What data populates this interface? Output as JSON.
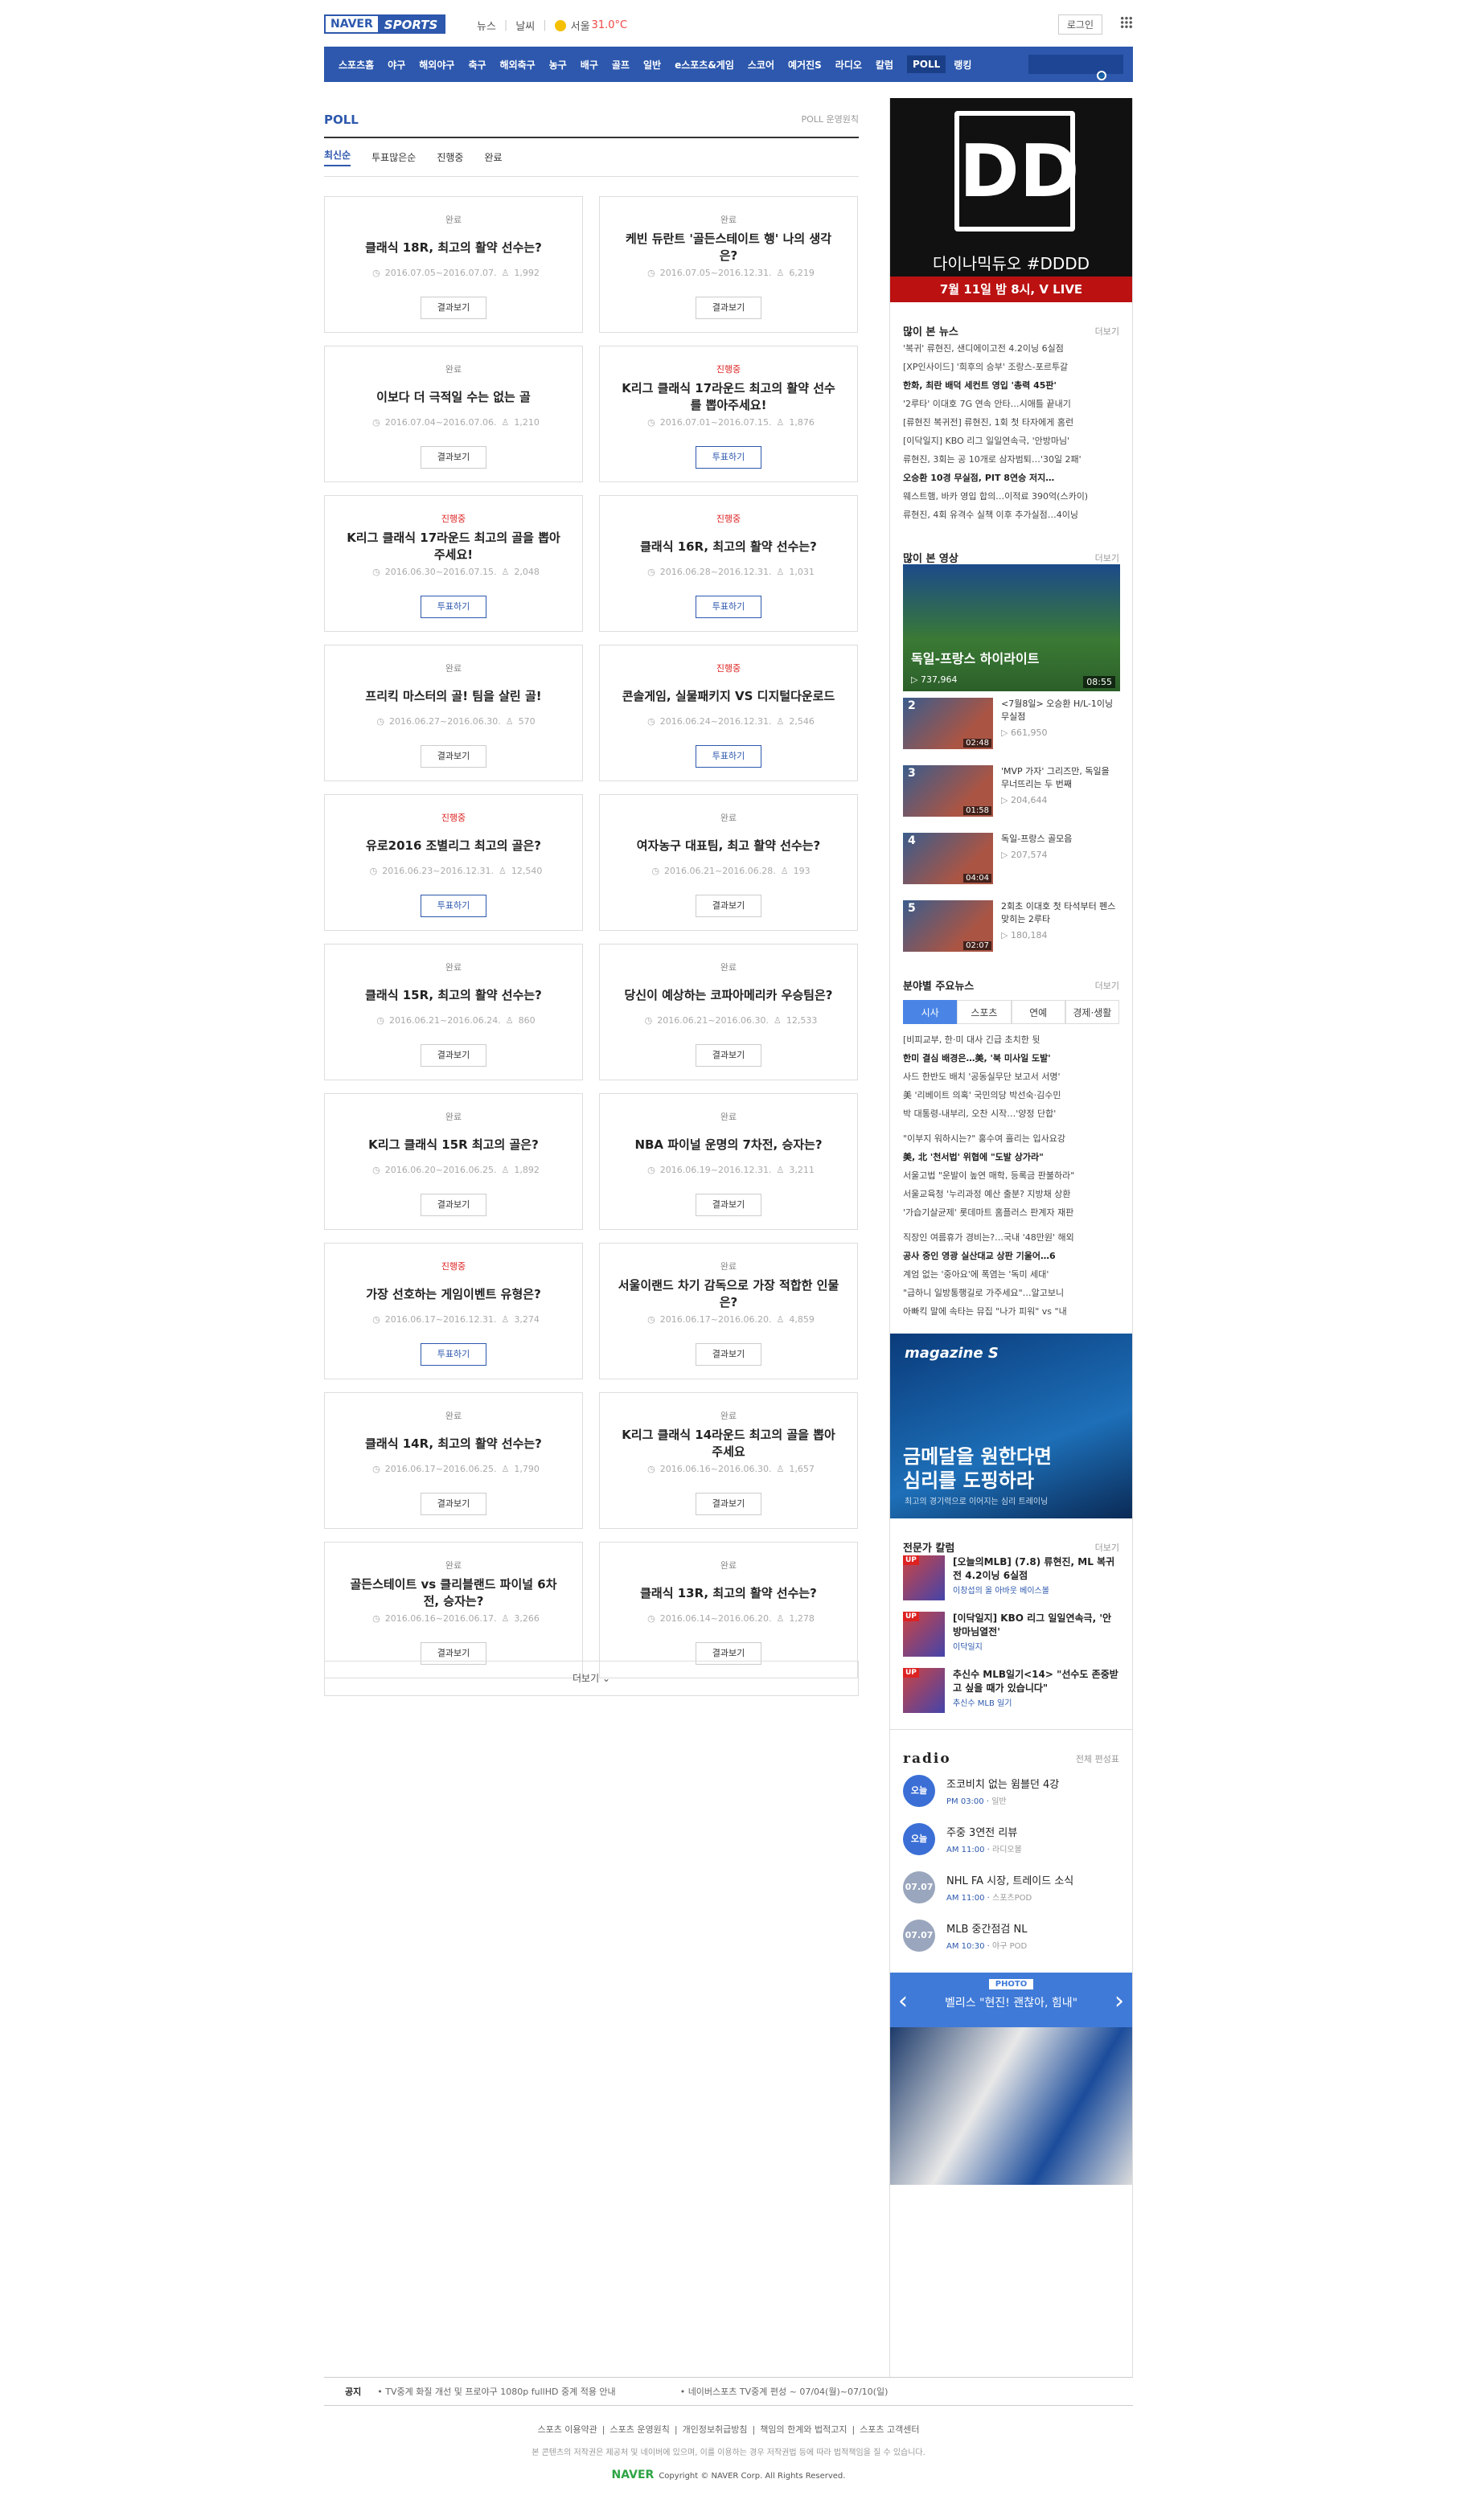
{
  "header": {
    "logo_naver": "NAVER",
    "logo_sports": "SPORTS",
    "menu": [
      "뉴스",
      "날씨"
    ],
    "weather": "서울",
    "temp": "31.0°C",
    "login": "로그인"
  },
  "gnb": [
    "스포츠홈",
    "야구",
    "해외야구",
    "축구",
    "해외축구",
    "농구",
    "배구",
    "골프",
    "일반",
    "e스포츠&게임",
    "스코어",
    "예거진S",
    "라디오",
    "칼럼",
    "POLL",
    "랭킹"
  ],
  "gnb_active": "POLL",
  "poll": {
    "title": "POLL",
    "policy": "POLL 운영원칙",
    "tabs": [
      "최신순",
      "투표많은순",
      "진행중",
      "완료"
    ],
    "more": "더보기"
  },
  "cards": [
    {
      "status": "완료",
      "q": "클래식 18R, 최고의 활약 선수는?",
      "date": "2016.07.05~2016.07.07.",
      "count": "1,992",
      "btn": "결과보기",
      "ing": false
    },
    {
      "status": "완료",
      "q": "케빈 듀란트 '골든스테이트 행' 나의 생각은?",
      "date": "2016.07.05~2016.12.31.",
      "count": "6,219",
      "btn": "결과보기",
      "ing": false
    },
    {
      "status": "완료",
      "q": "이보다 더 극적일 수는 없는 골",
      "date": "2016.07.04~2016.07.06.",
      "count": "1,210",
      "btn": "결과보기",
      "ing": false
    },
    {
      "status": "진행중",
      "q": "K리그 클래식 17라운드 최고의 활약 선수를 뽑아주세요!",
      "date": "2016.07.01~2016.07.15.",
      "count": "1,876",
      "btn": "투표하기",
      "ing": true
    },
    {
      "status": "진행중",
      "q": "K리그 클래식 17라운드 최고의 골을 뽑아주세요!",
      "date": "2016.06.30~2016.07.15.",
      "count": "2,048",
      "btn": "투표하기",
      "ing": true
    },
    {
      "status": "진행중",
      "q": "클래식 16R, 최고의 활약 선수는?",
      "date": "2016.06.28~2016.12.31.",
      "count": "1,031",
      "btn": "투표하기",
      "ing": true
    },
    {
      "status": "완료",
      "q": "프리킥 마스터의 골! 팀을 살린 골!",
      "date": "2016.06.27~2016.06.30.",
      "count": "570",
      "btn": "결과보기",
      "ing": false
    },
    {
      "status": "진행중",
      "q": "콘솔게임, 실물패키지 VS 디지털다운로드",
      "date": "2016.06.24~2016.12.31.",
      "count": "2,546",
      "btn": "투표하기",
      "ing": true
    },
    {
      "status": "진행중",
      "q": "유로2016 조별리그 최고의 골은?",
      "date": "2016.06.23~2016.12.31.",
      "count": "12,540",
      "btn": "투표하기",
      "ing": true
    },
    {
      "status": "완료",
      "q": "여자농구 대표팀, 최고 활약 선수는?",
      "date": "2016.06.21~2016.06.28.",
      "count": "193",
      "btn": "결과보기",
      "ing": false
    },
    {
      "status": "완료",
      "q": "클래식 15R, 최고의 활약 선수는?",
      "date": "2016.06.21~2016.06.24.",
      "count": "860",
      "btn": "결과보기",
      "ing": false
    },
    {
      "status": "완료",
      "q": "당신이 예상하는 코파아메리카 우승팀은?",
      "date": "2016.06.21~2016.06.30.",
      "count": "12,533",
      "btn": "결과보기",
      "ing": false
    },
    {
      "status": "완료",
      "q": "K리그 클래식 15R 최고의 골은?",
      "date": "2016.06.20~2016.06.25.",
      "count": "1,892",
      "btn": "결과보기",
      "ing": false
    },
    {
      "status": "완료",
      "q": "NBA 파이널 운명의 7차전, 승자는?",
      "date": "2016.06.19~2016.12.31.",
      "count": "3,211",
      "btn": "결과보기",
      "ing": false
    },
    {
      "status": "진행중",
      "q": "가장 선호하는 게임이벤트 유형은?",
      "date": "2016.06.17~2016.12.31.",
      "count": "3,274",
      "btn": "투표하기",
      "ing": true
    },
    {
      "status": "완료",
      "q": "서울이랜드 차기 감독으로 가장 적합한 인물은?",
      "date": "2016.06.17~2016.06.20.",
      "count": "4,859",
      "btn": "결과보기",
      "ing": false
    },
    {
      "status": "완료",
      "q": "클래식 14R, 최고의 활약 선수는?",
      "date": "2016.06.17~2016.06.25.",
      "count": "1,790",
      "btn": "결과보기",
      "ing": false
    },
    {
      "status": "완료",
      "q": "K리그 클래식 14라운드 최고의 골을 뽑아주세요",
      "date": "2016.06.16~2016.06.30.",
      "count": "1,657",
      "btn": "결과보기",
      "ing": false
    },
    {
      "status": "완료",
      "q": "골든스테이트 vs 클리블랜드 파이널 6차전, 승자는?",
      "date": "2016.06.16~2016.06.17.",
      "count": "3,266",
      "btn": "결과보기",
      "ing": false
    },
    {
      "status": "완료",
      "q": "클래식 13R, 최고의 활약 선수는?",
      "date": "2016.06.14~2016.06.20.",
      "count": "1,278",
      "btn": "결과보기",
      "ing": false
    }
  ],
  "ad": {
    "logo": "DD",
    "title": "다이나믹듀오 #DDDD",
    "sub": "7월 11일 밤 8시, V LIVE"
  },
  "news": {
    "title": "많이 본 뉴스",
    "more": "더보기",
    "items": [
      "'복귀' 류현진, 샌디에이고전 4.2이닝 6실점",
      "[XP인사이드] '희후의 승부' 조랑스-포르투갈",
      "한화, 최란 배덕 세컨트 영입 '총력 45판'",
      "'2루타' 이대호 7G 연속 안타…시애틀 끝내기",
      "[류현진 복귀전] 류현진, 1회 첫 타자에게 홈런",
      "[이닥일지] KBO 리그 일일연속극, '안방마님'",
      "류현진, 3회는 공 10개로 삼자범퇴…'30일 2패'",
      "오승환 10경 무실점, PIT 8연승 저지…",
      "웨스트햄, 바카 영입 합의…이적료 390억(스카이)",
      "류현진, 4회 유격수 실책 이후 추가실점…4이닝"
    ]
  },
  "video": {
    "title": "많이 본 영상",
    "more": "더보기",
    "top": {
      "t": "독일-프랑스 하이라이트",
      "c": "737,964",
      "d": "08:55"
    },
    "items": [
      {
        "n": "2",
        "t": "<7월8일> 오승환 H/L-1이닝 무실점",
        "c": "661,950",
        "d": "02:48"
      },
      {
        "n": "3",
        "t": "'MVP 가자' 그리즈만, 독일을 무너뜨리는 두 번째",
        "c": "204,644",
        "d": "01:58"
      },
      {
        "n": "4",
        "t": "독일-프랑스 골모음",
        "c": "207,574",
        "d": "04:04"
      },
      {
        "n": "5",
        "t": "2회초 이대호 첫 타석부터 펜스 맞히는 2루타",
        "c": "180,184",
        "d": "02:07"
      }
    ]
  },
  "field": {
    "title": "분야별 주요뉴스",
    "more": "더보기",
    "tabs": [
      "시사",
      "스포츠",
      "연예",
      "경제·생활"
    ],
    "items": [
      "[비피교부, 한·미 대사 긴급 초치한 뒷",
      "한미 결심 배경은…美, '북 미사일 도발'",
      "사드 한반도 배치 '공동실무단 보고서 서명'",
      "美 '리베이트 의혹' 국민의당 박선숙·김수민",
      "박 대통령-내부리, 오찬 시작…'양정 단합'",
      "\"이부지 워하시는?\" 홍수여 흘리는 입사요강",
      "美, 北 '천서법' 위협에 \"도발 상가라\"",
      "서울고법 \"운발이 높연 매학, 등록금 판불하라\"",
      "서울교육청 '누리과정 예산 출분? 지방채 상환",
      "'가습기살균제' 롯데마트 홈플러스 판계자 재판",
      "직장인 여름휴가 경비는?…국내 '48만원' 해외",
      "공사 중인 영광 실산대교 상판 기울어…6",
      "계엄 없는 '중아요'에 폭염는 '독미 세대'",
      "\"급하니 일방통행길로 가주세요\"…알고보니",
      "아빠킥 말에 속타는 뮤집 \"나가 피워\" vs \"내"
    ]
  },
  "magazine": {
    "logo": "magazine S",
    "title": "금메달을 원한다면 심리를 도핑하라",
    "sub": "최고의 경기력으로 이어지는 심리 트레이닝"
  },
  "experts": {
    "title": "전문가 칼럼",
    "more": "더보기",
    "items": [
      {
        "t": "[오늘의MLB] (7.8) 류현진, ML 복귀전 4.2이닝 6실점",
        "a": "이창섭의 올 아바웃 베이스볼"
      },
      {
        "t": "[이닥일지] KBO 리그 일일연속극, '안방마님열전'",
        "a": "이닥일지"
      },
      {
        "t": "추신수 MLB일기<14> \"선수도 존중받고 싶을 때가 있습니다\"",
        "a": "추신수 MLB 일기"
      }
    ],
    "badge": "UP"
  },
  "radio": {
    "title": "radio",
    "more": "전체 편성표",
    "items": [
      {
        "b": "오늘",
        "t": "조코비치 없는 윔블던 4강",
        "time": "PM 03:00",
        "ch": "일반",
        "g": false
      },
      {
        "b": "오늘",
        "t": "주중 3연전 리뷰",
        "time": "AM 11:00",
        "ch": "라디오볼",
        "g": false
      },
      {
        "b": "07.07",
        "t": "NHL FA 시장, 트레이드 소식",
        "time": "AM 11:00",
        "ch": "스포츠POD",
        "g": true
      },
      {
        "b": "07.07",
        "t": "MLB 중간점검 NL",
        "time": "AM 10:30",
        "ch": "야구 POD",
        "g": true
      }
    ]
  },
  "photo": {
    "label": "PHOTO",
    "title": "벨리스 \"현진! 괜찮아, 힘내\""
  },
  "notice": {
    "label": "공지",
    "items": [
      "TV중계 화질 개선 및 프로야구 1080p fullHD 중계 적용 안내",
      "네이버스포츠 TV중계 편성 ~ 07/04(월)~07/10(일)"
    ]
  },
  "footer": {
    "links": [
      "스포츠 이용약관",
      "스포츠 운영원칙",
      "개인정보취급방침",
      "책임의 한계와 법적고지",
      "스포츠 고객센터"
    ],
    "copy": "본 콘텐츠의 저작권은 제공처 및 네이버에 있으며, 이를 이용하는 경우 저작권법 등에 따라 법적책임을 질 수 있습니다.",
    "naver": "NAVER",
    "corp": "Copyright © NAVER Corp. All Rights Reserved."
  }
}
